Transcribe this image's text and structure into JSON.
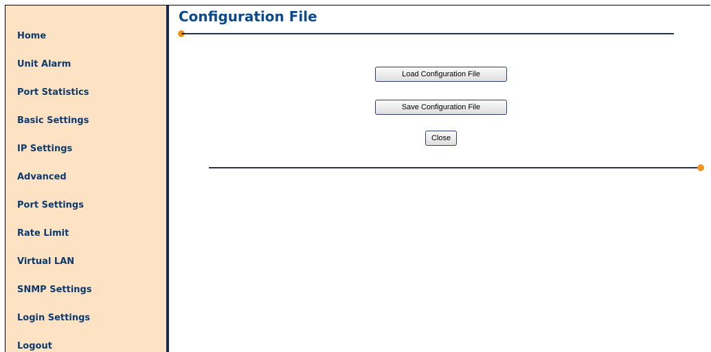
{
  "sidebar": {
    "items": [
      {
        "label": "Home"
      },
      {
        "label": "Unit Alarm"
      },
      {
        "label": "Port Statistics"
      },
      {
        "label": "Basic Settings"
      },
      {
        "label": "IP Settings"
      },
      {
        "label": "Advanced"
      },
      {
        "label": "Port Settings"
      },
      {
        "label": "Rate Limit"
      },
      {
        "label": "Virtual LAN"
      },
      {
        "label": "SNMP Settings"
      },
      {
        "label": "Login Settings"
      },
      {
        "label": "Logout"
      }
    ]
  },
  "main": {
    "title": "Configuration File",
    "buttons": {
      "load_label": "Load Configuration File",
      "save_label": "Save Configuration File",
      "close_label": "Close"
    }
  },
  "colors": {
    "sidebar_bg": "#fde3c3",
    "sidebar_text": "#0c3a6e",
    "title": "#0c4a8a",
    "accent_dot": "#f29322",
    "rule": "#27304a"
  }
}
